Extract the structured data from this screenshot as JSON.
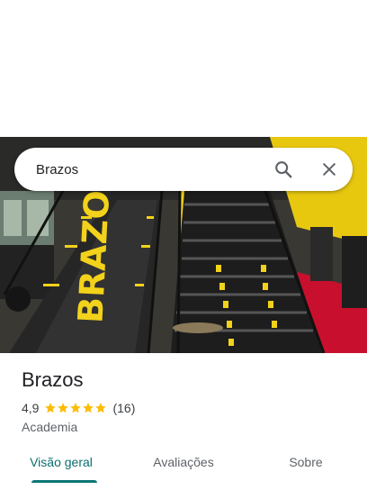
{
  "search": {
    "query": "Brazos"
  },
  "photo": {
    "sign_text": "BRAZOS"
  },
  "place": {
    "name": "Brazos",
    "rating": "4,9",
    "stars": 5,
    "review_count": "(16)",
    "category": "Academia"
  },
  "tabs": [
    {
      "label": "Visão geral",
      "active": true
    },
    {
      "label": "Avaliações",
      "active": false
    },
    {
      "label": "Sobre",
      "active": false
    }
  ],
  "colors": {
    "accent": "#0b7775",
    "star": "#fbbc04",
    "gym_yellow": "#f2d21a",
    "floor_red": "#c8102e"
  },
  "icons": [
    "search-icon",
    "close-icon",
    "star-icon"
  ]
}
